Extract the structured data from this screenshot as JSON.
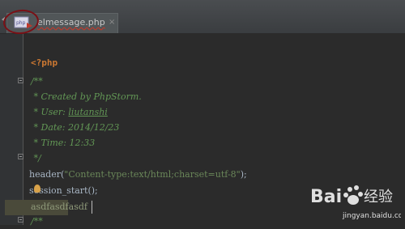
{
  "tab": {
    "filename": "elmessage.php",
    "close_glyph": "×",
    "icon": "php-file-icon"
  },
  "code_lines": [
    "<?php",
    "/**",
    " * Created by PhpStorm.",
    " * User: liutanshi",
    " * Date: 2014/12/23",
    " * Time: 12:33",
    " */",
    "header(\"Content-type:text/html;charset=utf-8\");",
    "session_start();",
    "asdfasdfasdf",
    "/**"
  ],
  "code_parts": {
    "created_by": " * Created by PhpStorm.",
    "user_prefix": " * User: ",
    "user_name": "liutanshi",
    "header_fn": "header(",
    "header_str": "\"Content-type:text/html;charset=utf-8\"",
    "header_end": ");"
  },
  "watermark": {
    "brand": "Bai",
    "brand2": "百",
    "site": "经验",
    "url": "jingyan.baidu.com"
  },
  "colors": {
    "background": "#2b2b2b",
    "keyword": "#cc7832",
    "comment": "#629755",
    "string": "#6a8759",
    "text": "#a9b7c6",
    "annotation": "#7a1016"
  }
}
